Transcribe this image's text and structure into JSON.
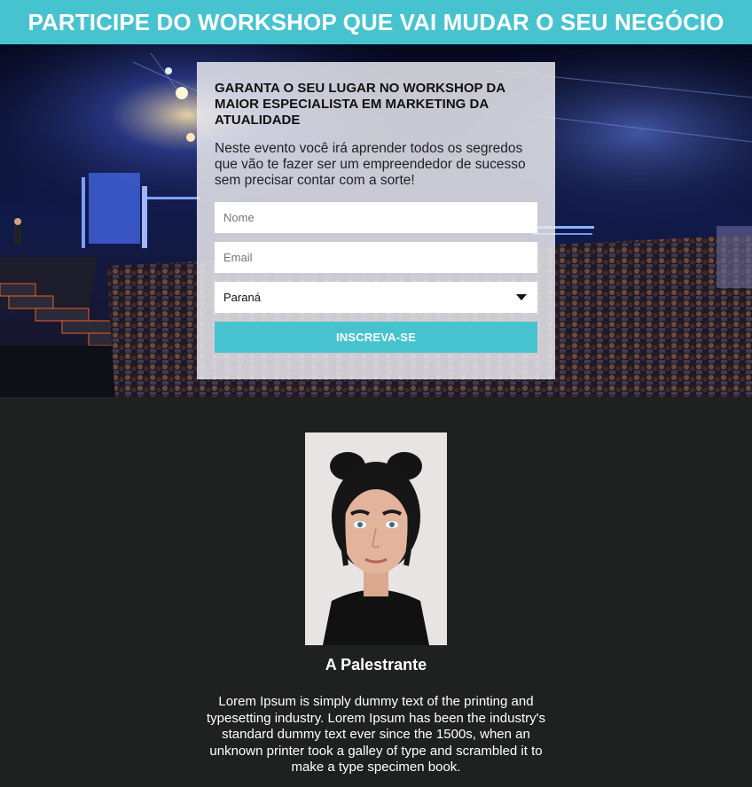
{
  "banner": {
    "title": "PARTICIPE DO WORKSHOP QUE VAI MUDAR O SEU NEGÓCIO"
  },
  "form": {
    "title": "GARANTA O SEU LUGAR NO WORKSHOP DA MAIOR ESPECIALISTA EM MARKETING DA ATUALIDADE",
    "description": "Neste evento você irá aprender todos os segredos que vão te fazer ser um empreendedor de sucesso sem precisar contar com a sorte!",
    "name_placeholder": "Nome",
    "email_placeholder": "Email",
    "state_selected": "Paraná",
    "submit_label": "INSCREVA-SE"
  },
  "speaker": {
    "title": "A Palestrante",
    "bio": "Lorem Ipsum is simply dummy text of the printing and typesetting industry. Lorem Ipsum has been the industry's standard dummy text ever since the 1500s, when an unknown printer took a galley of type and scrambled it to make a type specimen book."
  },
  "colors": {
    "accent": "#47c3cf",
    "dark_background": "#1f2020"
  }
}
